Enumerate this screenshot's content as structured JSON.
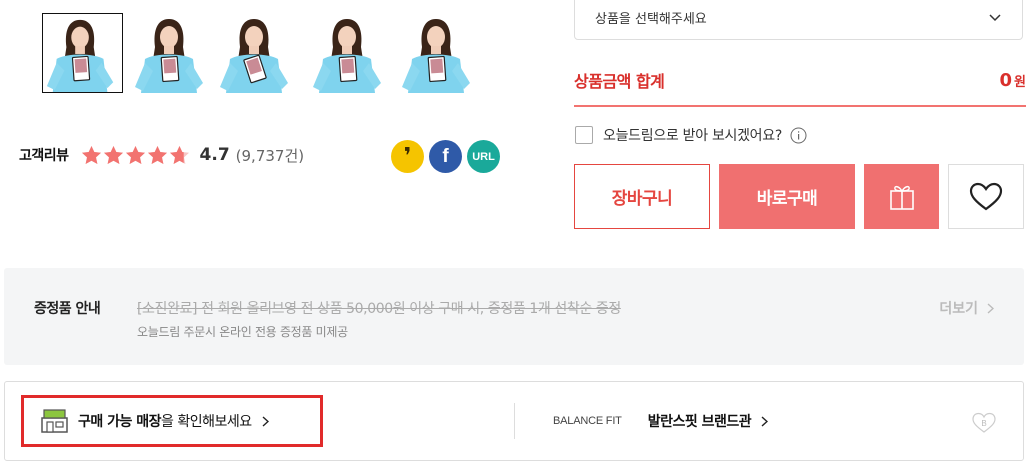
{
  "thumbnails": [
    {
      "name": "product-thumbnail-1",
      "selected": true
    },
    {
      "name": "product-thumbnail-2",
      "selected": false
    },
    {
      "name": "product-thumbnail-3",
      "selected": false
    },
    {
      "name": "product-thumbnail-4",
      "selected": false
    },
    {
      "name": "product-thumbnail-5",
      "selected": false
    }
  ],
  "review": {
    "label": "고객리뷰",
    "rating": 4.7,
    "score_text": "4.7",
    "count_text": "(9,737건)",
    "star_color": "#f27370"
  },
  "share": {
    "kakao_glyph": "❜",
    "facebook_glyph": "f",
    "url_label": "URL"
  },
  "option_select": {
    "placeholder": "상품을 선택해주세요"
  },
  "total": {
    "label": "상품금액 합계",
    "amount": "0",
    "unit": "원"
  },
  "today_dream": {
    "label": "오늘드림으로 받아 보시겠어요?"
  },
  "buttons": {
    "cart": "장바구니",
    "buy": "바로구매"
  },
  "gift_notice": {
    "title": "증정품 안내",
    "line1": "[소진완료] 전 회원 올리브영 전 상품 50,000원 이상 구매 시, 증정품 1개 선착순 증정",
    "line2": "오늘드림 주문시 온라인 전용 증정품 미제공",
    "more": "더보기"
  },
  "store": {
    "strong": "구매 가능 매장",
    "rest": "을 확인해보세요"
  },
  "brand": {
    "english": "BALANCE FIT",
    "korean": "발란스핏 브랜드관",
    "heart_letter": "B"
  },
  "colors": {
    "accent": "#f07070",
    "accent_text": "#d9302c",
    "highlight_border": "#e12a2a"
  }
}
